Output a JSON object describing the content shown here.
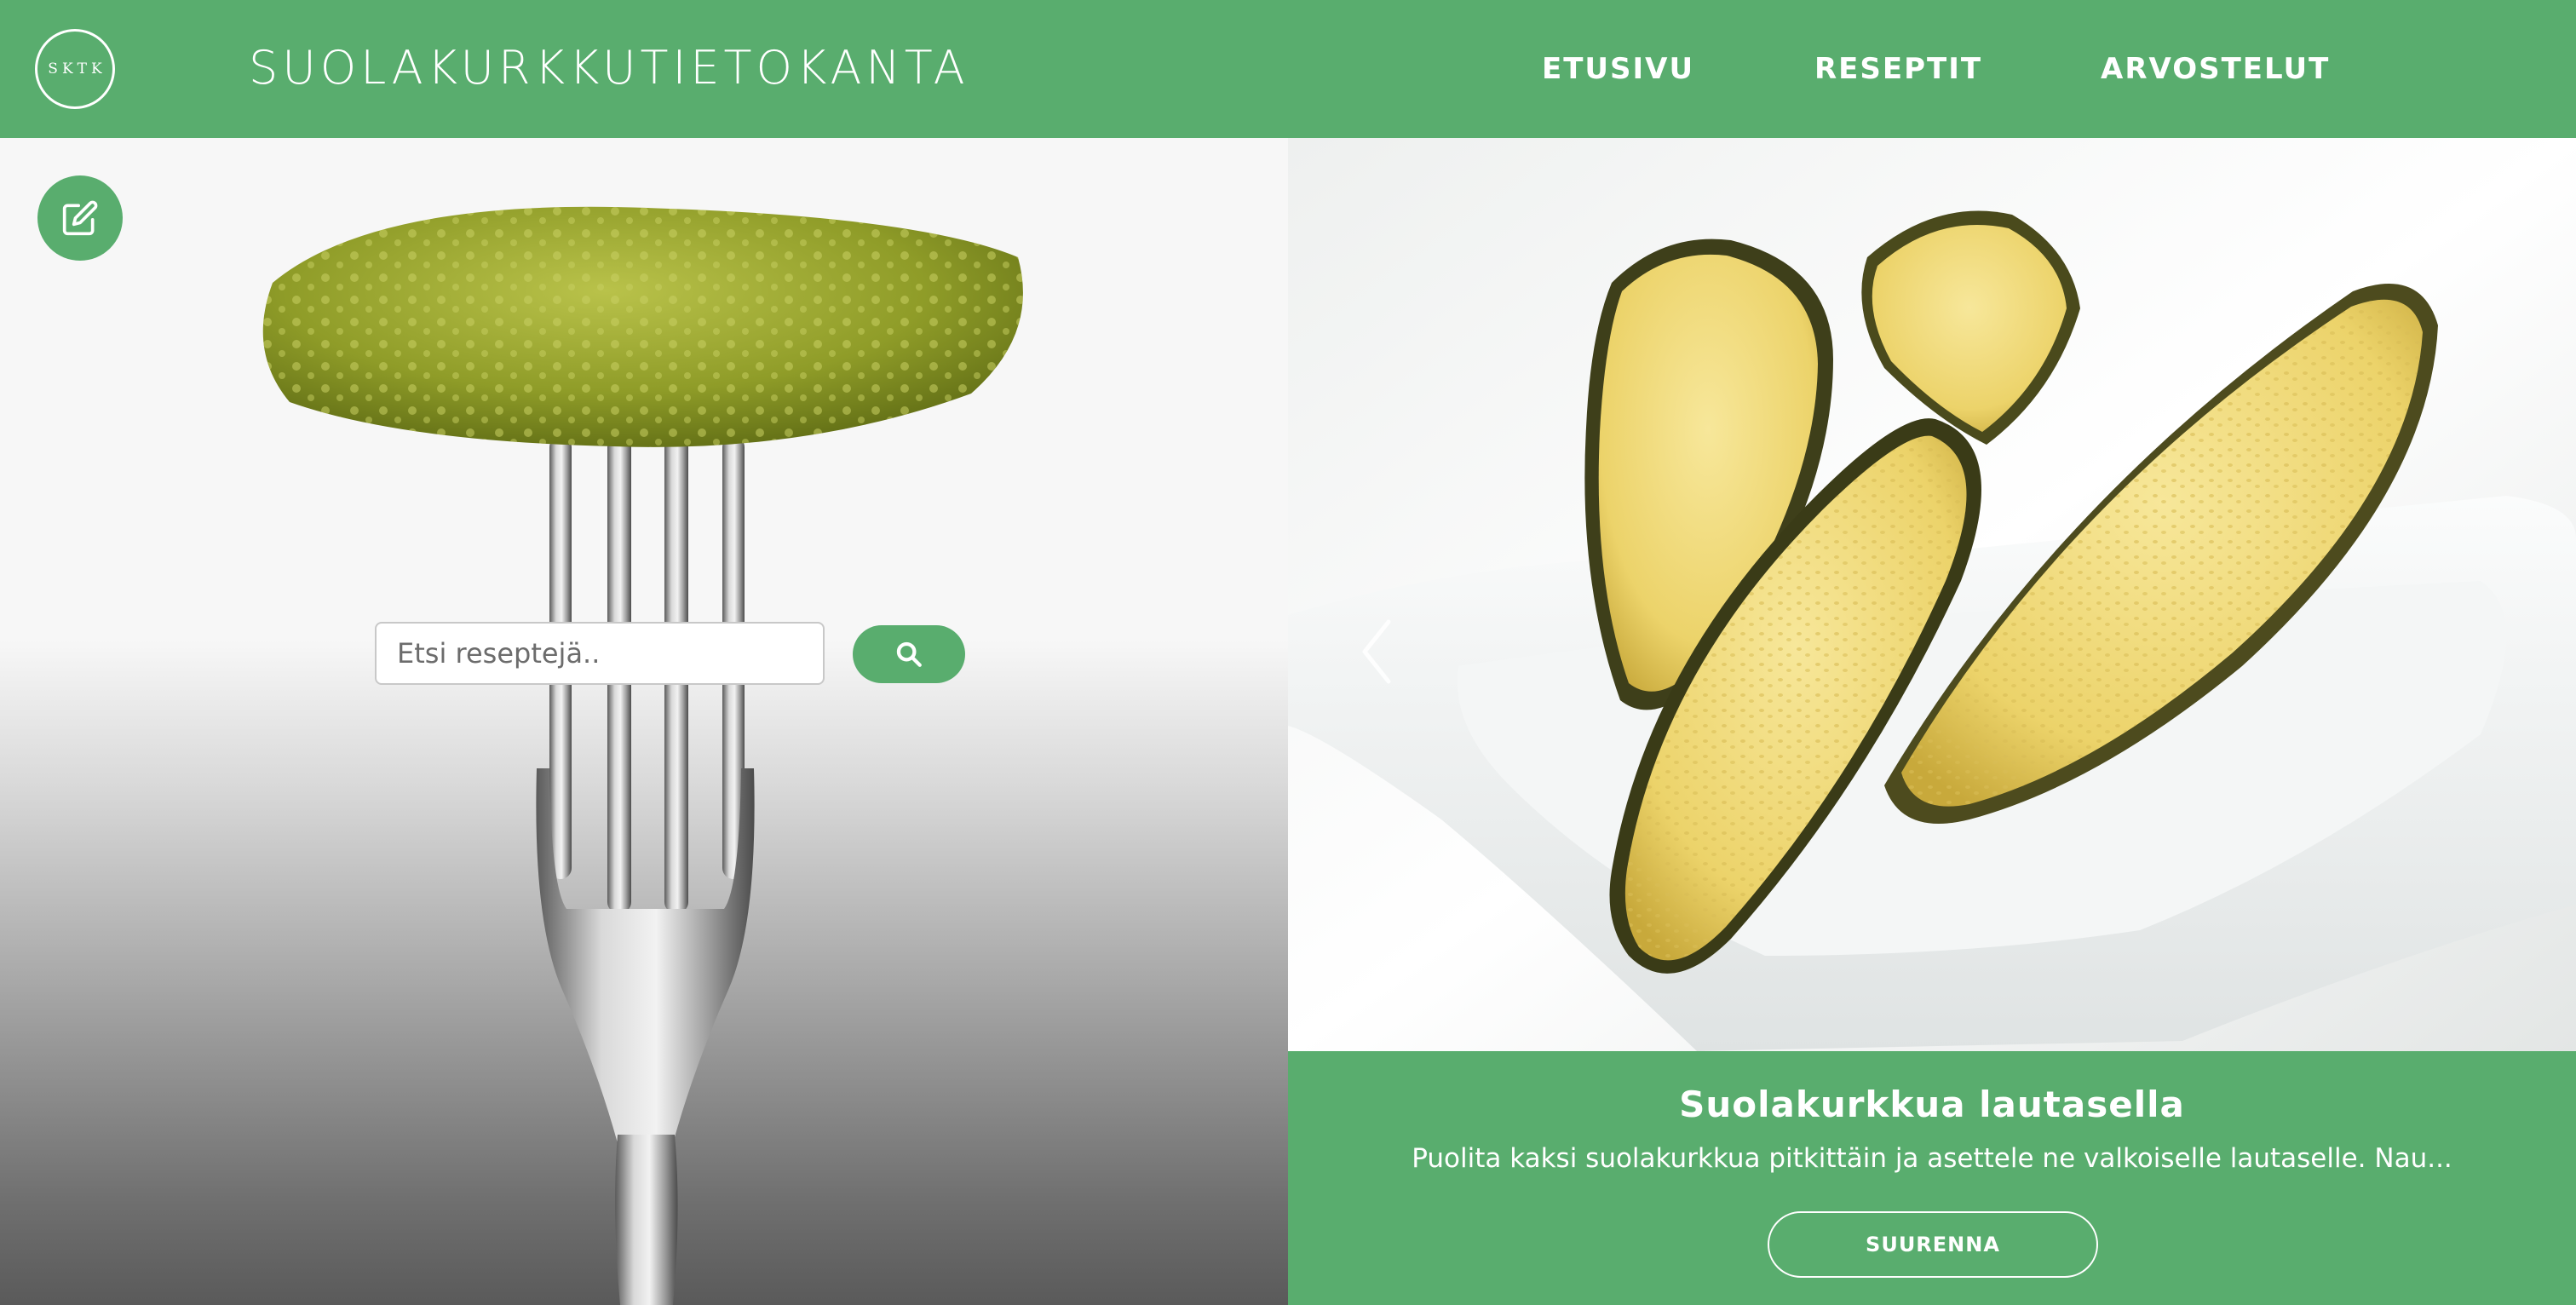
{
  "header": {
    "logo_text": "SKTK",
    "title": "SUOLAKURKKUTIETOKANTA",
    "nav": {
      "home": "ETUSIVU",
      "recipes": "RESEPTIT",
      "reviews": "ARVOSTELUT"
    }
  },
  "hero": {
    "edit_icon": "edit-icon",
    "search": {
      "placeholder": "Etsi reseptejä..",
      "value": "",
      "button_icon": "search-icon"
    }
  },
  "carousel": {
    "prev_icon": "chevron-left-icon",
    "caption": {
      "title": "Suolakurkkua lautasella",
      "text": "Puolita kaksi suolakurkkua pitkittäin ja asettele ne valkoiselle lautaselle. Nau...",
      "button_label": "SUURENNA"
    }
  },
  "colors": {
    "brand_green": "#59ad6e",
    "white": "#ffffff"
  }
}
